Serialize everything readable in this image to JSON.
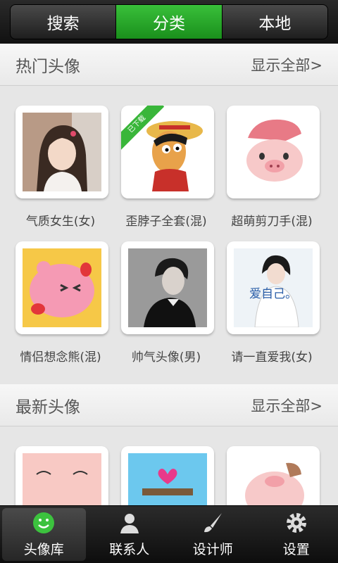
{
  "top_tabs": [
    {
      "label": "搜索"
    },
    {
      "label": "分类"
    },
    {
      "label": "本地"
    }
  ],
  "active_tab": "分类",
  "sections": [
    {
      "title": "热门头像",
      "show_all": "显示全部>",
      "items": [
        {
          "caption": "气质女生(女)",
          "icon": "girl-photo"
        },
        {
          "caption": "歪脖子全套(混)",
          "icon": "luffy-cartoon",
          "badge": "已下载"
        },
        {
          "caption": "超萌剪刀手(混)",
          "icon": "pig-cartoon"
        },
        {
          "caption": "情侣想念熊(混)",
          "icon": "pink-bear-cartoon"
        },
        {
          "caption": "帅气头像(男)",
          "icon": "boy-photo"
        },
        {
          "caption": "请一直爱我(女)",
          "icon": "girl-text-photo",
          "overlay_text": "爱自己。"
        }
      ]
    },
    {
      "title": "最新头像",
      "show_all": "显示全部>",
      "items": [
        {
          "caption": "",
          "icon": "pink-face-cartoon"
        },
        {
          "caption": "",
          "icon": "heart-cartoon"
        },
        {
          "caption": "",
          "icon": "pig-cartoon"
        }
      ]
    }
  ],
  "bottom_nav": [
    {
      "label": "头像库",
      "icon": "smiley-icon"
    },
    {
      "label": "联系人",
      "icon": "person-icon"
    },
    {
      "label": "设计师",
      "icon": "brush-icon"
    },
    {
      "label": "设置",
      "icon": "gear-icon"
    }
  ],
  "active_nav": "头像库",
  "colors": {
    "accent": "#2aa82c",
    "bar": "#1a1a1a"
  }
}
